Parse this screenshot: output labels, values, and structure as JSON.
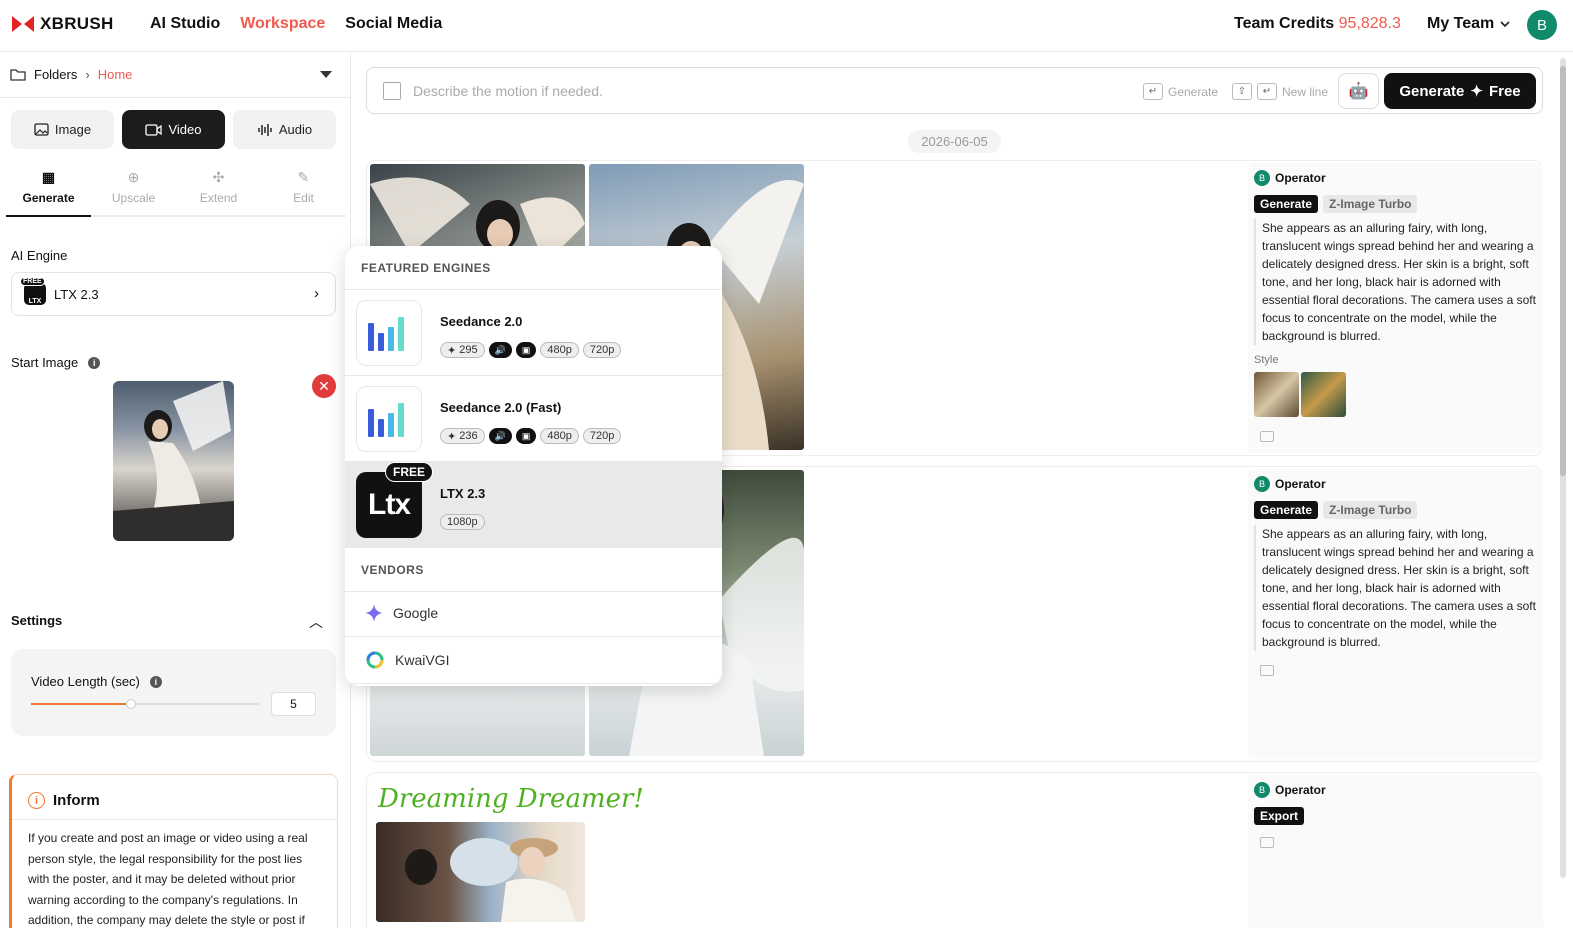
{
  "header": {
    "brand": "XBRUSH",
    "nav": [
      "AI Studio",
      "Workspace",
      "Social Media"
    ],
    "credits_label": "Team Credits",
    "credits_value": "95,828.3",
    "team": "My Team",
    "avatar": "B"
  },
  "sidebar": {
    "breadcrumb": {
      "folders": "Folders",
      "home": "Home"
    },
    "media_tabs": [
      "Image",
      "Video",
      "Audio"
    ],
    "tool_tabs": [
      "Generate",
      "Upscale",
      "Extend",
      "Edit"
    ],
    "ai_engine_label": "AI Engine",
    "engine_free": "FREE",
    "engine_logo_text": "LTX",
    "engine_value": "LTX 2.3",
    "start_image_label": "Start Image",
    "settings_label": "Settings",
    "video_length_label": "Video Length (sec)",
    "video_length_value": "5",
    "video_length_fraction": 0.44,
    "inform_title": "Inform",
    "inform_text": "If you create and post an image or video using a real person style, the legal responsibility for the post lies with the poster, and it may be deleted without prior warning according to the company's regulations. In addition, the company may delete the style or post if"
  },
  "prompt": {
    "placeholder": "Describe the motion if needed.",
    "hint_generate": "Generate",
    "hint_newline": "New line",
    "generate_label": "Generate",
    "generate_free": "Free"
  },
  "feed": {
    "date": "2026-06-05",
    "cards": [
      {
        "operator": "Operator",
        "tag1": "Generate",
        "tag2": "Z-Image Turbo",
        "description": "She appears as an alluring fairy, with long, translucent wings spread behind her and wearing a delicately designed dress. Her skin is a bright, soft tone, and her long, black hair is adorned with essential floral decorations. The camera uses a soft focus to concentrate on the model, while the background is blurred.",
        "style_label": "Style"
      },
      {
        "operator": "Operator",
        "tag1": "Generate",
        "tag2": "Z-Image Turbo",
        "description": "She appears as an alluring fairy, with long, translucent wings spread behind her and wearing a delicately designed dress. Her skin is a bright, soft tone, and her long, black hair is adorned with essential floral decorations. The camera uses a soft focus to concentrate on the model, while the background is blurred."
      },
      {
        "operator": "Operator",
        "tag1": "Export",
        "title": "Dreaming Dreamer!"
      }
    ]
  },
  "dropdown": {
    "featured_header": "FEATURED ENGINES",
    "engines": [
      {
        "name": "Seedance 2.0",
        "credits": "295",
        "res": [
          "480p",
          "720p"
        ]
      },
      {
        "name": "Seedance 2.0 (Fast)",
        "credits": "236",
        "res": [
          "480p",
          "720p"
        ]
      },
      {
        "name": "LTX 2.3",
        "badge": "FREE",
        "logo_text": "Ltx",
        "res": [
          "1080p"
        ]
      }
    ],
    "vendors_header": "VENDORS",
    "vendors": [
      "Google",
      "KwaiVGI"
    ]
  },
  "colors": {
    "accent": "#f05a4f",
    "avatar": "#118a6b",
    "slider": "#f07a2e"
  }
}
